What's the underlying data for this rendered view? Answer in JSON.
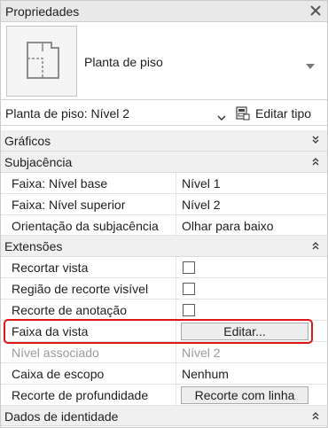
{
  "window": {
    "title": "Propriedades",
    "close_icon": "close-icon"
  },
  "type_selector": {
    "thumbnail_icon": "floor-plan-icon",
    "type_name": "Planta de piso",
    "dropdown_icon": "caret-down-icon"
  },
  "instance_selector": {
    "label": "Planta de piso: Nível 2",
    "dropdown_icon": "chevron-down-icon",
    "edit_type_icon": "edit-type-icon",
    "edit_type_label": "Editar tipo"
  },
  "categories": {
    "graficos": {
      "label": "Gráficos",
      "state_icon": "expand-icon"
    },
    "subjacencia": {
      "label": "Subjacência",
      "state_icon": "collapse-icon"
    },
    "extensoes": {
      "label": "Extensões",
      "state_icon": "collapse-icon"
    },
    "dados_identidade": {
      "label": "Dados de identidade",
      "state_icon": "collapse-icon"
    }
  },
  "properties": {
    "faixa_nivel_base": {
      "name": "Faixa: Nível base",
      "value": "Nível 1"
    },
    "faixa_nivel_superior": {
      "name": "Faixa: Nível superior",
      "value": "Nível 2"
    },
    "orientacao_subjacencia": {
      "name": "Orientação da subjacência",
      "value": "Olhar para baixo"
    },
    "recortar_vista": {
      "name": "Recortar vista",
      "checked": false
    },
    "regiao_recorte_visivel": {
      "name": "Região de recorte visível",
      "checked": false
    },
    "recorte_anotacao": {
      "name": "Recorte de anotação",
      "checked": false
    },
    "faixa_da_vista": {
      "name": "Faixa da vista",
      "button": "Editar..."
    },
    "nivel_associado": {
      "name": "Nível associado",
      "value": "Nível 2",
      "disabled": true
    },
    "caixa_escopo": {
      "name": "Caixa de escopo",
      "value": "Nenhum"
    },
    "recorte_profundidade": {
      "name": "Recorte de profundidade",
      "button": "Recorte com linha"
    }
  },
  "colors": {
    "highlight": "#e01515",
    "category_bg": "#f0f0f0",
    "titlebar_bg": "#e9e9e9",
    "disabled_text": "#9a9a9a"
  }
}
